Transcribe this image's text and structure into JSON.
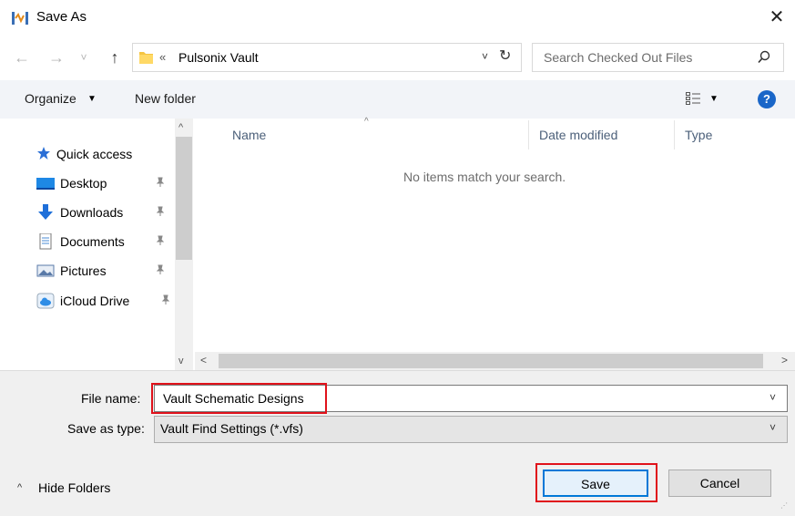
{
  "window": {
    "title": "Save As",
    "close_glyph": "✕",
    "icon": "pulsonix-app-icon"
  },
  "nav": {
    "back_glyph": "←",
    "forward_glyph": "→",
    "recent_glyph": "˅",
    "up_glyph": "↑",
    "address_prefix": "«",
    "address": "Pulsonix Vault",
    "address_dropdown_glyph": "˅",
    "refresh_glyph": "↻",
    "search_placeholder": "Search Checked Out Files"
  },
  "toolbar": {
    "organize_label": "Organize",
    "caret_glyph": "▼",
    "new_folder_label": "New folder",
    "help_glyph": "?"
  },
  "navpane": {
    "quick_access_label": "Quick access",
    "items": [
      {
        "label": "Desktop",
        "icon": "desktop-icon",
        "pinned": true
      },
      {
        "label": "Downloads",
        "icon": "downloads-icon",
        "pinned": true
      },
      {
        "label": "Documents",
        "icon": "documents-icon",
        "pinned": true
      },
      {
        "label": "Pictures",
        "icon": "pictures-icon",
        "pinned": true
      },
      {
        "label": "iCloud Drive",
        "icon": "icloud-icon",
        "pinned": true
      }
    ],
    "pin_glyph": "📌",
    "scroll_up_glyph": "^",
    "scroll_down_glyph": "v"
  },
  "filelist": {
    "columns": [
      "Name",
      "Date modified",
      "Type"
    ],
    "sort_glyph": "^",
    "empty_message": "No items match your search.",
    "scroll_left_glyph": "<",
    "scroll_right_glyph": ">"
  },
  "form": {
    "file_name_label": "File name:",
    "file_name_value": "Vault Schematic Designs",
    "save_as_type_label": "Save as type:",
    "save_as_type_value": "Vault Find Settings (*.vfs)",
    "dropdown_glyph": "˅"
  },
  "footer": {
    "hide_folders_caret": "^",
    "hide_folders_label": "Hide Folders",
    "save_label": "Save",
    "cancel_label": "Cancel",
    "grip_glyph": "⋰"
  },
  "colors": {
    "highlight": "#e0121b",
    "accent": "#0078d7",
    "toolbar_bg": "#f2f4f8",
    "form_bg": "#f0f0f0",
    "header_text": "#4c607a"
  }
}
